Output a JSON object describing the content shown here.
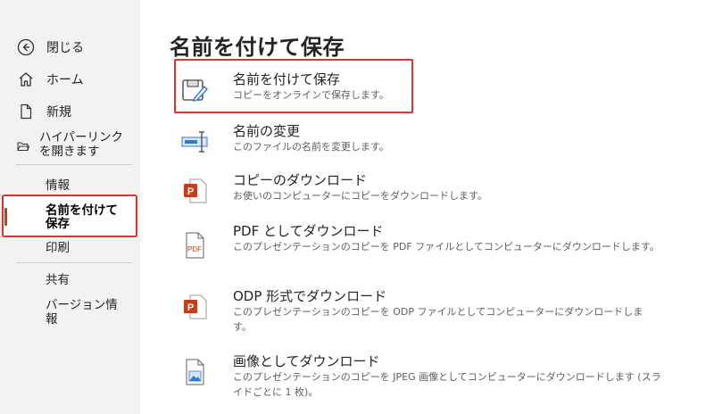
{
  "sidebar": {
    "close": "閉じる",
    "home": "ホーム",
    "new": "新規",
    "open_hyperlink_1": "ハイパーリンク",
    "open_hyperlink_2": "を開きます",
    "info": "情報",
    "save_as_1": "名前を付けて",
    "save_as_2": "保存",
    "print": "印刷",
    "share": "共有",
    "version_1": "バージョン情",
    "version_2": "報"
  },
  "main": {
    "title": "名前を付けて保存",
    "options": [
      {
        "title": "名前を付けて保存",
        "desc": "コピーをオンラインで保存します。",
        "icon": "save-as-icon"
      },
      {
        "title": "名前の変更",
        "desc": "このファイルの名前を変更します。",
        "icon": "rename-icon"
      },
      {
        "title": "コピーのダウンロード",
        "desc": "お使いのコンピューターにコピーをダウンロードします。",
        "icon": "powerpoint-file-icon"
      },
      {
        "title": "PDF としてダウンロード",
        "desc": "このプレゼンテーションのコピーを PDF ファイルとしてコンピューターにダウンロードします。",
        "icon": "pdf-file-icon"
      },
      {
        "title": "ODP 形式でダウンロード",
        "desc": "このプレゼンテーションのコピーを ODP ファイルとしてコンピューターにダウンロードします。",
        "icon": "powerpoint-file-icon"
      },
      {
        "title": "画像としてダウンロード",
        "desc": "このプレゼンテーションのコピーを JPEG 画像としてコンピューターにダウンロードします (スライドごとに 1 枚)。",
        "icon": "image-file-icon"
      }
    ]
  },
  "colors": {
    "accent": "#c43e1c",
    "highlight": "#e0302a",
    "sidebar_bg": "#f3f2f1"
  }
}
